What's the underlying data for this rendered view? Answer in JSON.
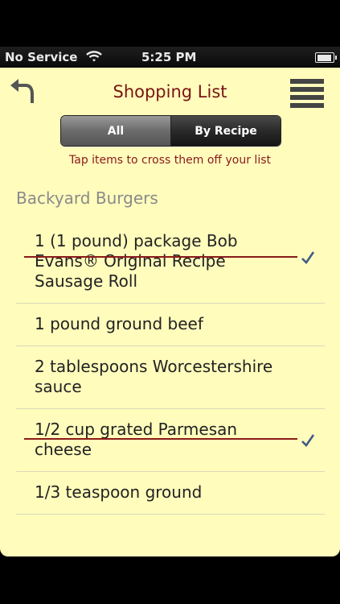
{
  "status_bar": {
    "carrier": "No Service",
    "time": "5:25 PM"
  },
  "header": {
    "title": "Shopping List",
    "back_icon": "back-arrow-icon",
    "menu_icon": "hamburger-menu-icon"
  },
  "segments": {
    "all": "All",
    "by_recipe": "By Recipe",
    "selected": "All"
  },
  "hint": "Tap items to cross them off your list",
  "section": {
    "title": "Backyard Burgers"
  },
  "items": [
    {
      "text": "1 (1 pound) package Bob Evans® Original Recipe Sausage Roll",
      "checked": true
    },
    {
      "text": "1 pound ground beef",
      "checked": false
    },
    {
      "text": "2 tablespoons Worcestershire sauce",
      "checked": false
    },
    {
      "text": "1/2 cup grated Parmesan cheese",
      "checked": true
    },
    {
      "text": "1/3 teaspoon ground",
      "checked": false
    }
  ],
  "colors": {
    "background": "#fffcbc",
    "title": "#7a1414",
    "strike": "#8a1a1a",
    "check": "#3f5a8a"
  }
}
